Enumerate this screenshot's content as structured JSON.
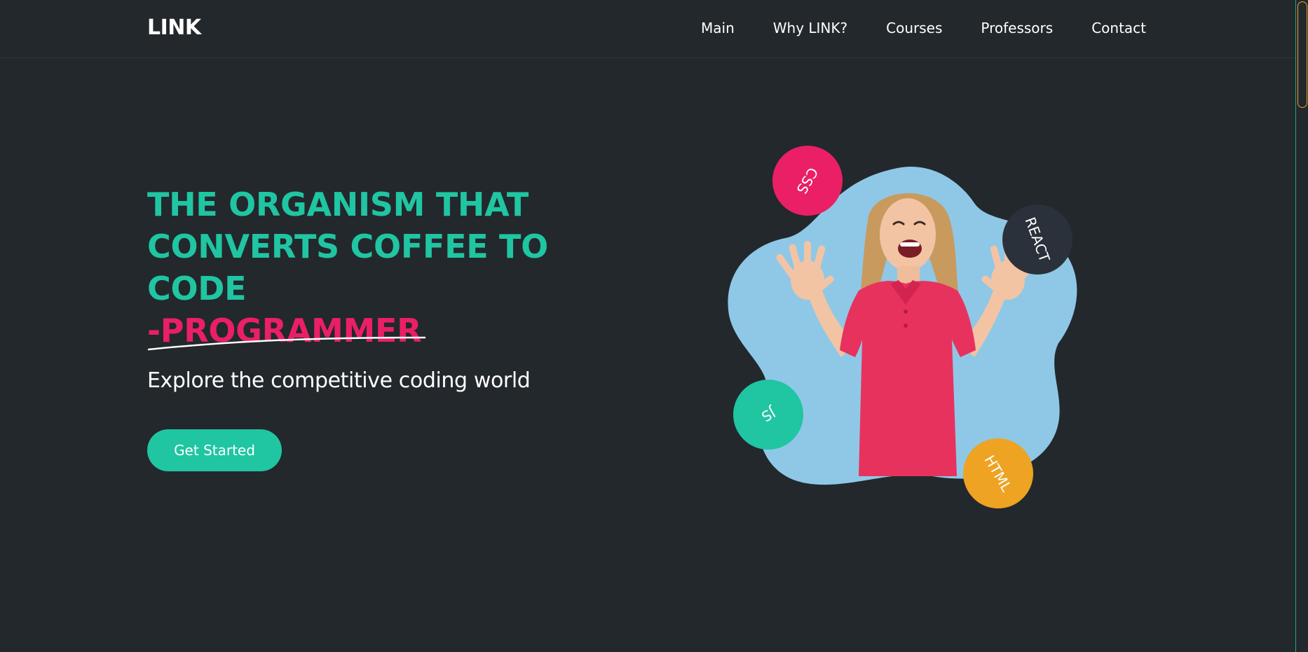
{
  "navbar": {
    "logo": "LINK",
    "links": [
      "Main",
      "Why LINK?",
      "Courses",
      "Professors",
      "Contact"
    ]
  },
  "hero": {
    "headline": "THE ORGANISM THAT CONVERTS COFFEE TO CODE",
    "accent": "-PROGRAMMER",
    "subtitle": "Explore the competitive coding world",
    "cta_label": "Get Started"
  },
  "illustration": {
    "badges": {
      "css": "CSS",
      "react": "REACT",
      "js": "JS",
      "html": "HTML"
    }
  },
  "colors": {
    "background": "#23282d",
    "teal": "#20c5a2",
    "pink": "#ea1f66",
    "orange": "#eea323",
    "dark_badge": "#2b313a",
    "blob": "#8fc8e6"
  }
}
